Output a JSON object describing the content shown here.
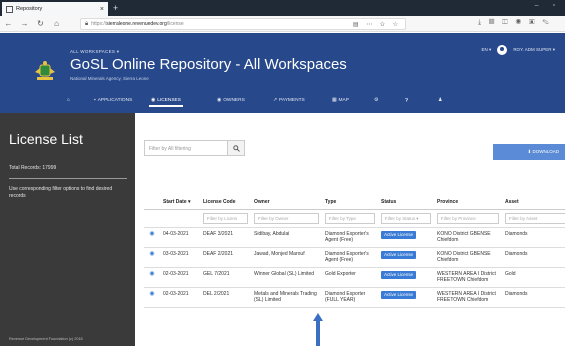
{
  "browser": {
    "tab_title": "Repository",
    "url_prefix": "https://",
    "url_host": "sierraleone.revenuedev.org",
    "url_path": "/license"
  },
  "header": {
    "workspaces_label": "ALL WORKSPACES ▾",
    "title": "GoSL Online Repository - All Workspaces",
    "subtitle": "National Minerals Agency, Sierra Leone",
    "language": "EN ▾",
    "user": "ROY. ADM SUPER ▾",
    "nav": [
      {
        "label": "APPLICATIONS",
        "icon": "briefcase-icon"
      },
      {
        "label": "LICENSES",
        "icon": "eye-icon",
        "active": true
      },
      {
        "label": "OWNERS",
        "icon": "users-icon"
      },
      {
        "label": "PAYMENTS",
        "icon": "chart-icon"
      },
      {
        "label": "MAP",
        "icon": "map-icon"
      }
    ]
  },
  "sidebar": {
    "title": "License List",
    "total": "Total Records: 17999",
    "hint": "Use corresponding filter options to find desired records",
    "footer": "Revenue Development Foundation (c) 2018"
  },
  "filter": {
    "placeholder": "Filter by All filtering",
    "download_label": "⬇ DOWNLOAD"
  },
  "table": {
    "headers": [
      "Start Date",
      "License Code",
      "Owner",
      "Type",
      "Status",
      "Province",
      "Asset"
    ],
    "filters": [
      "",
      "Filter by Licens",
      "Filter by Owner",
      "Filter by Type",
      "Filter by Status ▾",
      "Filter by Province",
      "Filter by Asset"
    ],
    "rows": [
      {
        "date": "04-03-2021",
        "code": "DEAF 3/2021",
        "owner": "Sidibay, Abdulai",
        "type": "Diamond Exporter's Agent (Free)",
        "status": "Active License",
        "province": "KONO District GBENSE Chiefdom",
        "asset": "Diamonds"
      },
      {
        "date": "03-03-2021",
        "code": "DEAF 2/2021",
        "owner": "Jawad, Monjed Marouf",
        "type": "Diamond Exporter's Agent (Free)",
        "status": "Active License",
        "province": "KONO District GBENSE Chiefdom",
        "asset": "Diamonds"
      },
      {
        "date": "02-03-2021",
        "code": "GEL 7/2021",
        "owner": "Winner Global (SL) Limited",
        "type": "Gold Exporter",
        "status": "Active License",
        "province": "WESTERN AREA I District FREETOWN Chiefdom",
        "asset": "Gold"
      },
      {
        "date": "02-03-2021",
        "code": "DEL 2/2021",
        "owner": "Metals and Minerals Trading (SL) Limited",
        "type": "Diamond Exporter (FULL YEAR)",
        "status": "Active License",
        "province": "WESTERN AREA I District FREETOWN Chiefdom",
        "asset": "Diamonds"
      }
    ]
  },
  "colors": {
    "header_bg": "#27488b",
    "sidebar_bg": "#3a3a3a",
    "accent": "#3a7bd5",
    "download_bg": "#5b8bd6"
  }
}
